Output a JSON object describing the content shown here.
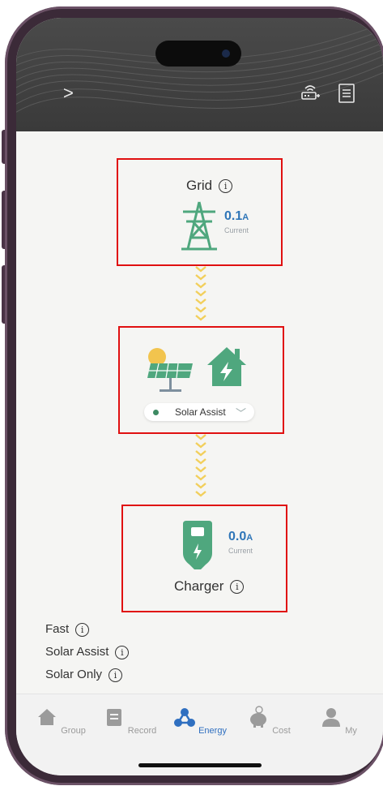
{
  "header": {
    "back_glyph": ">",
    "icons": [
      "router-add-icon",
      "document-list-icon"
    ]
  },
  "grid": {
    "title": "Grid",
    "value": "0.1",
    "unit": "A",
    "caption": "Current"
  },
  "mode_selector": {
    "selected": "Solar Assist",
    "icons": [
      "solar-panel-icon",
      "house-charging-icon"
    ],
    "status_color": "#3d8a63"
  },
  "charger": {
    "title": "Charger",
    "value": "0.0",
    "unit": "A",
    "caption": "Current"
  },
  "modes": [
    {
      "label": "Fast"
    },
    {
      "label": "Solar Assist"
    },
    {
      "label": "Solar Only"
    }
  ],
  "tabs": [
    {
      "label": "Group",
      "active": false
    },
    {
      "label": "Record",
      "active": false
    },
    {
      "label": "Energy",
      "active": true
    },
    {
      "label": "Cost",
      "active": false
    },
    {
      "label": "My",
      "active": false
    }
  ],
  "colors": {
    "accent_blue": "#2f76b8",
    "active_tab": "#2f6fc0",
    "green": "#4fa77e",
    "highlight_box": "#e01010",
    "flow_arrow": "#f2cf5b"
  }
}
